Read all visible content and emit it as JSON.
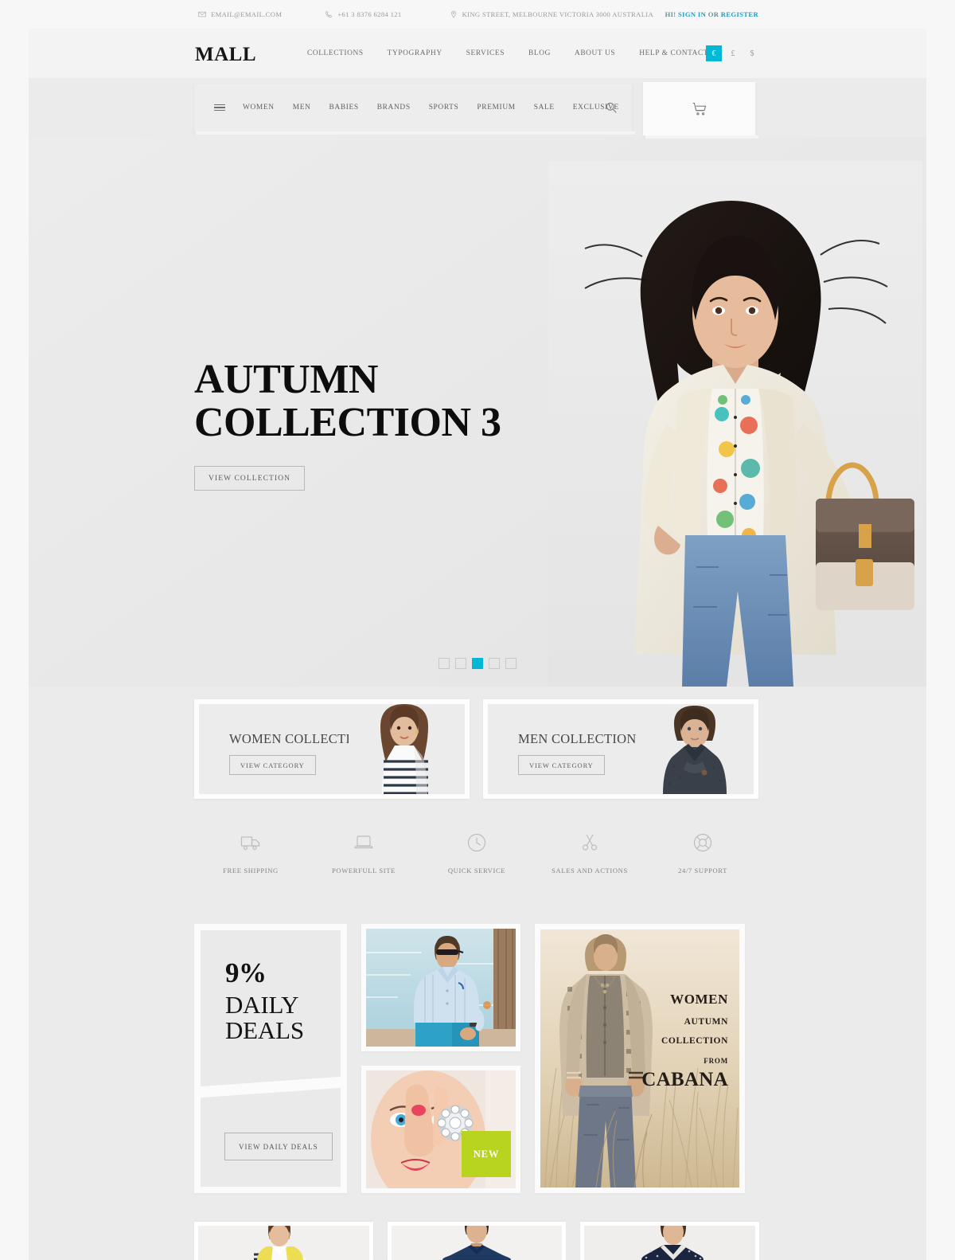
{
  "topbar": {
    "email": "EMAIL@EMAIL.COM",
    "phone": "+61 3 8376 6284 121",
    "address": "KING STREET, MELBOURNE VICTORIA 3000 AUSTRALIA",
    "hi": "HI!",
    "sign_in": "SIGN IN",
    "or": "OR",
    "register": "REGISTER"
  },
  "header": {
    "logo": "MALL",
    "nav": [
      {
        "label": "COLLECTIONS"
      },
      {
        "label": "TYPOGRAPHY"
      },
      {
        "label": "SERVICES"
      },
      {
        "label": "BLOG"
      },
      {
        "label": "ABOUT US"
      },
      {
        "label": "HELP & CONTACT"
      }
    ],
    "currencies": [
      {
        "symbol": "€",
        "active": true
      },
      {
        "symbol": "£",
        "active": false
      },
      {
        "symbol": "$",
        "active": false
      }
    ]
  },
  "navstrip": {
    "menu_icon": "hamburger-icon",
    "items": [
      {
        "label": "WOMEN"
      },
      {
        "label": "MEN"
      },
      {
        "label": "BABIES"
      },
      {
        "label": "BRANDS"
      },
      {
        "label": "SPORTS"
      },
      {
        "label": "PREMIUM"
      },
      {
        "label": "SALE"
      },
      {
        "label": "EXCLUSIVE"
      }
    ],
    "search_icon": "search-icon",
    "cart_icon": "cart-icon"
  },
  "hero": {
    "title": "AUTUMN\nCOLLECTION 3",
    "button": "VIEW COLLECTION",
    "slides_total": 5,
    "active_slide": 3
  },
  "categories": [
    {
      "title": "WOMEN COLLECTION",
      "button": "VIEW CATEGORY"
    },
    {
      "title": "MEN COLLECTION",
      "button": "VIEW CATEGORY"
    }
  ],
  "features": [
    {
      "icon": "truck-icon",
      "label": "FREE SHIPPING"
    },
    {
      "icon": "laptop-icon",
      "label": "POWERFULL SITE"
    },
    {
      "icon": "clock-icon",
      "label": "QUICK SERVICE"
    },
    {
      "icon": "scissors-icon",
      "label": "SALES AND ACTIONS"
    },
    {
      "icon": "lifering-icon",
      "label": "24/7 SUPPORT"
    }
  ],
  "deals": {
    "percent": "9%",
    "heading": "DAILY\nDEALS",
    "button": "VIEW DAILY DEALS"
  },
  "tiles": {
    "badge_new": "NEW"
  },
  "cabana": {
    "line1": "WOMEN",
    "line2": "AUTUMN",
    "line3": "COLLECTION",
    "line4": "FROM",
    "line5": "CABANA"
  },
  "colors": {
    "accent_cyan": "#00b7d4",
    "badge_green": "#b9d41e",
    "link_blue": "#1a9fc4",
    "page_bg": "#f7f7f7",
    "sheet_bg": "#ebebeb"
  }
}
